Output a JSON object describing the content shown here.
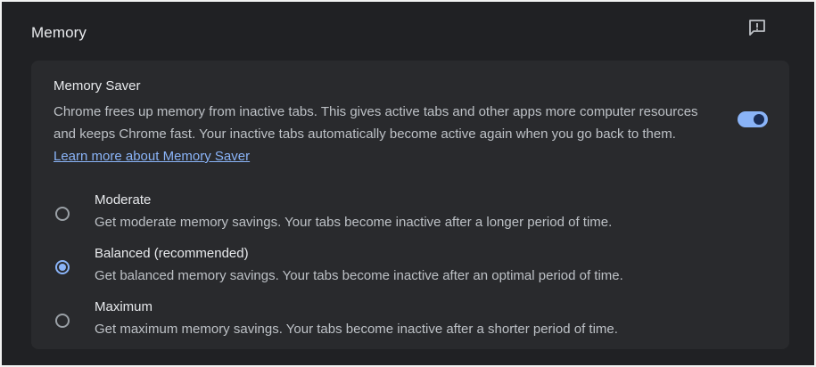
{
  "page": {
    "title": "Memory",
    "feedback_icon": "feedback-icon"
  },
  "memory_saver": {
    "title": "Memory Saver",
    "description": "Chrome frees up memory from inactive tabs. This gives active tabs and other apps more computer resources and keeps Chrome fast. Your inactive tabs automatically become active again when you go back to them.",
    "learn_more_link": "Learn more about Memory Saver",
    "enabled": true
  },
  "options": [
    {
      "label": "Moderate",
      "description": "Get moderate memory savings. Your tabs become inactive after a longer period of time.",
      "selected": false
    },
    {
      "label": "Balanced (recommended)",
      "description": "Get balanced memory savings. Your tabs become inactive after an optimal period of time.",
      "selected": true
    },
    {
      "label": "Maximum",
      "description": "Get maximum memory savings. Your tabs become inactive after a shorter period of time.",
      "selected": false
    }
  ],
  "colors": {
    "background": "#202124",
    "card": "#292a2d",
    "accent": "#8ab4f8",
    "text_primary": "#e8eaed",
    "text_secondary": "#bdc1c6"
  }
}
